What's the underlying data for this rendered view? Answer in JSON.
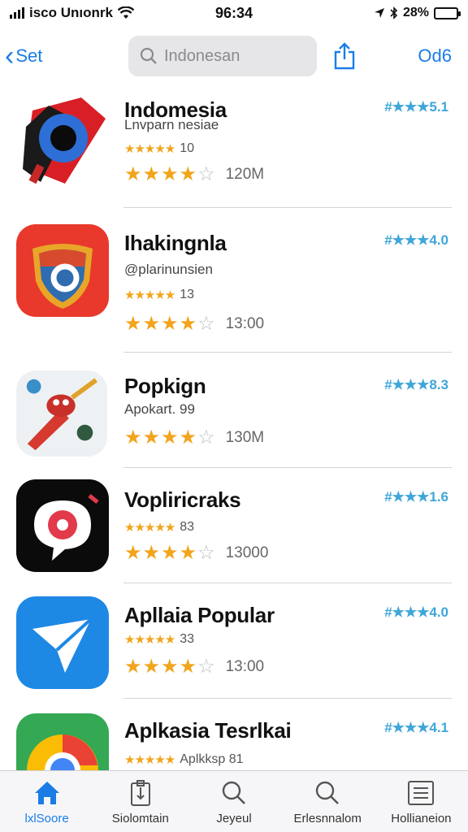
{
  "status_bar": {
    "carrier": "isco Unıonrk",
    "time": "96:34",
    "battery": "28%",
    "battery_level": 0.28
  },
  "nav": {
    "back_label": "Set",
    "search_placeholder": "Indonesan",
    "right_label": "Od6"
  },
  "apps": [
    {
      "name": "Indomesia",
      "subtitle": "Lnvparn nesiae",
      "mini_rating": "10",
      "big_rating_value": 4.5,
      "count": "120M",
      "side_rating": "#★★★5.1"
    },
    {
      "name": "Ihakingnla",
      "subtitle": "@plarinunsien",
      "mini_rating": "13",
      "big_rating_value": 4.5,
      "count": "13:00",
      "side_rating": "#★★★4.0"
    },
    {
      "name": "Popkign",
      "subtitle": "Apokart. 99",
      "mini_rating": "",
      "big_rating_value": 4.5,
      "count": "130M",
      "side_rating": "#★★★8.3"
    },
    {
      "name": "Vopliricraks",
      "subtitle": "",
      "mini_rating": "83",
      "big_rating_value": 4.5,
      "count": "13000",
      "side_rating": "#★★★1.6"
    },
    {
      "name": "Apllaia Popular",
      "subtitle": "",
      "mini_rating": "33",
      "big_rating_value": 4.5,
      "count": "13:00",
      "side_rating": "#★★★4.0"
    },
    {
      "name": "Aplkasia Tesrlkai",
      "subtitle": "",
      "mini_rating": "Aplkksp 81",
      "big_rating_value": 4.5,
      "count": "",
      "side_rating": "#★★★4.1"
    }
  ],
  "tabs": [
    {
      "label": "lxlSoore",
      "icon": "home-icon",
      "active": true
    },
    {
      "label": "Siolomtain",
      "icon": "clipboard-icon",
      "active": false
    },
    {
      "label": "Jeyeul",
      "icon": "search-icon",
      "active": false
    },
    {
      "label": "Erlesnnalom",
      "icon": "search-icon",
      "active": false
    },
    {
      "label": "Hollianeion",
      "icon": "list-icon",
      "active": false
    }
  ],
  "colors": {
    "accent": "#1a7de6",
    "star": "#f2a41b",
    "side_rating": "#3ea6d9"
  }
}
